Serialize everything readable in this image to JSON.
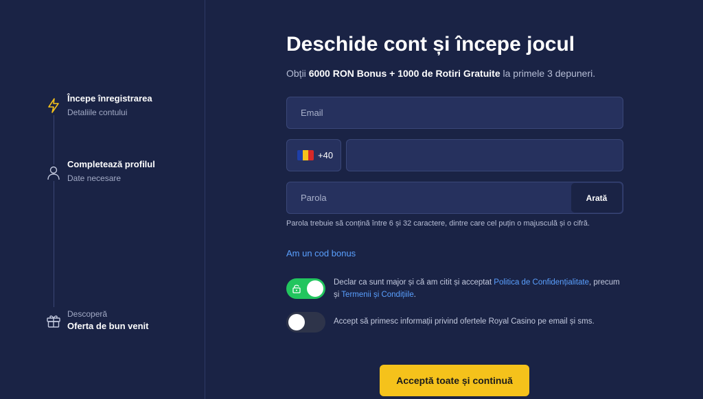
{
  "steps": [
    {
      "title": "Începe înregistrarea",
      "subtitle": "Detaliile contului",
      "icon": "lightning-icon"
    },
    {
      "title": "Completează profilul",
      "subtitle": "Date necesare",
      "icon": "user-icon"
    },
    {
      "title": "Oferta de bun venit",
      "subtitle": "Descoperă",
      "icon": "gift-icon"
    }
  ],
  "form": {
    "heading": "Deschide cont și începe jocul",
    "subheading_pre": "Obții ",
    "subheading_bold": "6000 RON Bonus + 1000 de Rotiri Gratuite",
    "subheading_post": " la primele 3 depuneri.",
    "email_placeholder": "Email",
    "dial_code": "+40",
    "phone_value": "",
    "password_placeholder": "Parola",
    "show_label": "Arată",
    "password_hint": "Parola trebuie să conțină între 6 și 32 caractere, dintre care cel puțin o majusculă și o cifră.",
    "bonus_link": "Am un cod bonus",
    "consent1_pre": "Declar ca sunt major și că am citit și acceptat ",
    "consent1_link1": "Politica de Confidențialitate",
    "consent1_mid": ", precum și ",
    "consent1_link2": "Termenii și Condițiile",
    "consent1_post": ".",
    "consent1_on": true,
    "consent2": "Accept să primesc informații privind ofertele Royal Casino pe email și sms.",
    "consent2_on": false,
    "submit_label": "Acceptă toate și continuă"
  },
  "colors": {
    "background": "#1a2345",
    "accent_yellow": "#f5c21b",
    "toggle_on": "#22c55e",
    "link": "#5aa0ff"
  }
}
